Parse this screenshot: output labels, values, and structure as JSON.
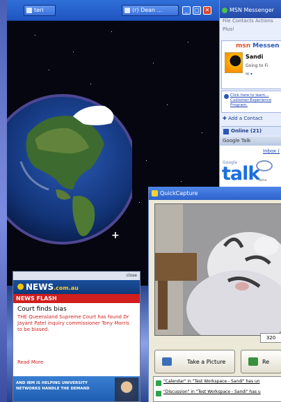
{
  "taskbar": {
    "buttons": [
      {
        "label": "teri"
      },
      {
        "label": "(r) Dean ..."
      }
    ]
  },
  "msn": {
    "title": "MSN Messenger",
    "menu": "File  Contacts  Actions",
    "sub_menu": "Plus!",
    "brand_left": "msn",
    "brand_right": "Messen",
    "user_name": "Sandi",
    "status": "Going to Fi",
    "info_link": "Click here to learn... Customer Experience Program.",
    "add_contact": "Add a Contact",
    "online": "Online (21)"
  },
  "gtalk": {
    "title": "Google Talk",
    "inbox": "Inbox (",
    "google": "Google",
    "logo": "talk",
    "beta": "beta"
  },
  "quickcapture": {
    "title": "QuickCapture",
    "resolution": "320",
    "take_picture": "Take a Picture",
    "record": "Re",
    "log": [
      "\"Calendar\" in \"Test Workspace - Sandi\" has un",
      "\"Discussion\" in \"Test Workspace - Sandi\" has u"
    ]
  },
  "news": {
    "close": "close",
    "brand": "NEWS",
    "brand_domain": ".com.au",
    "flash": "NEWS FLASH",
    "headline": "Court finds bias",
    "body": "THE Queensland Supreme Court has found Dr Jayant Patel inquiry commissioner Tony Morris to be biased.",
    "more": "Read More",
    "ad_text": "AND IBM IS HELPING UNIVERSITY NETWORKS HANDLE THE DEMAND"
  }
}
